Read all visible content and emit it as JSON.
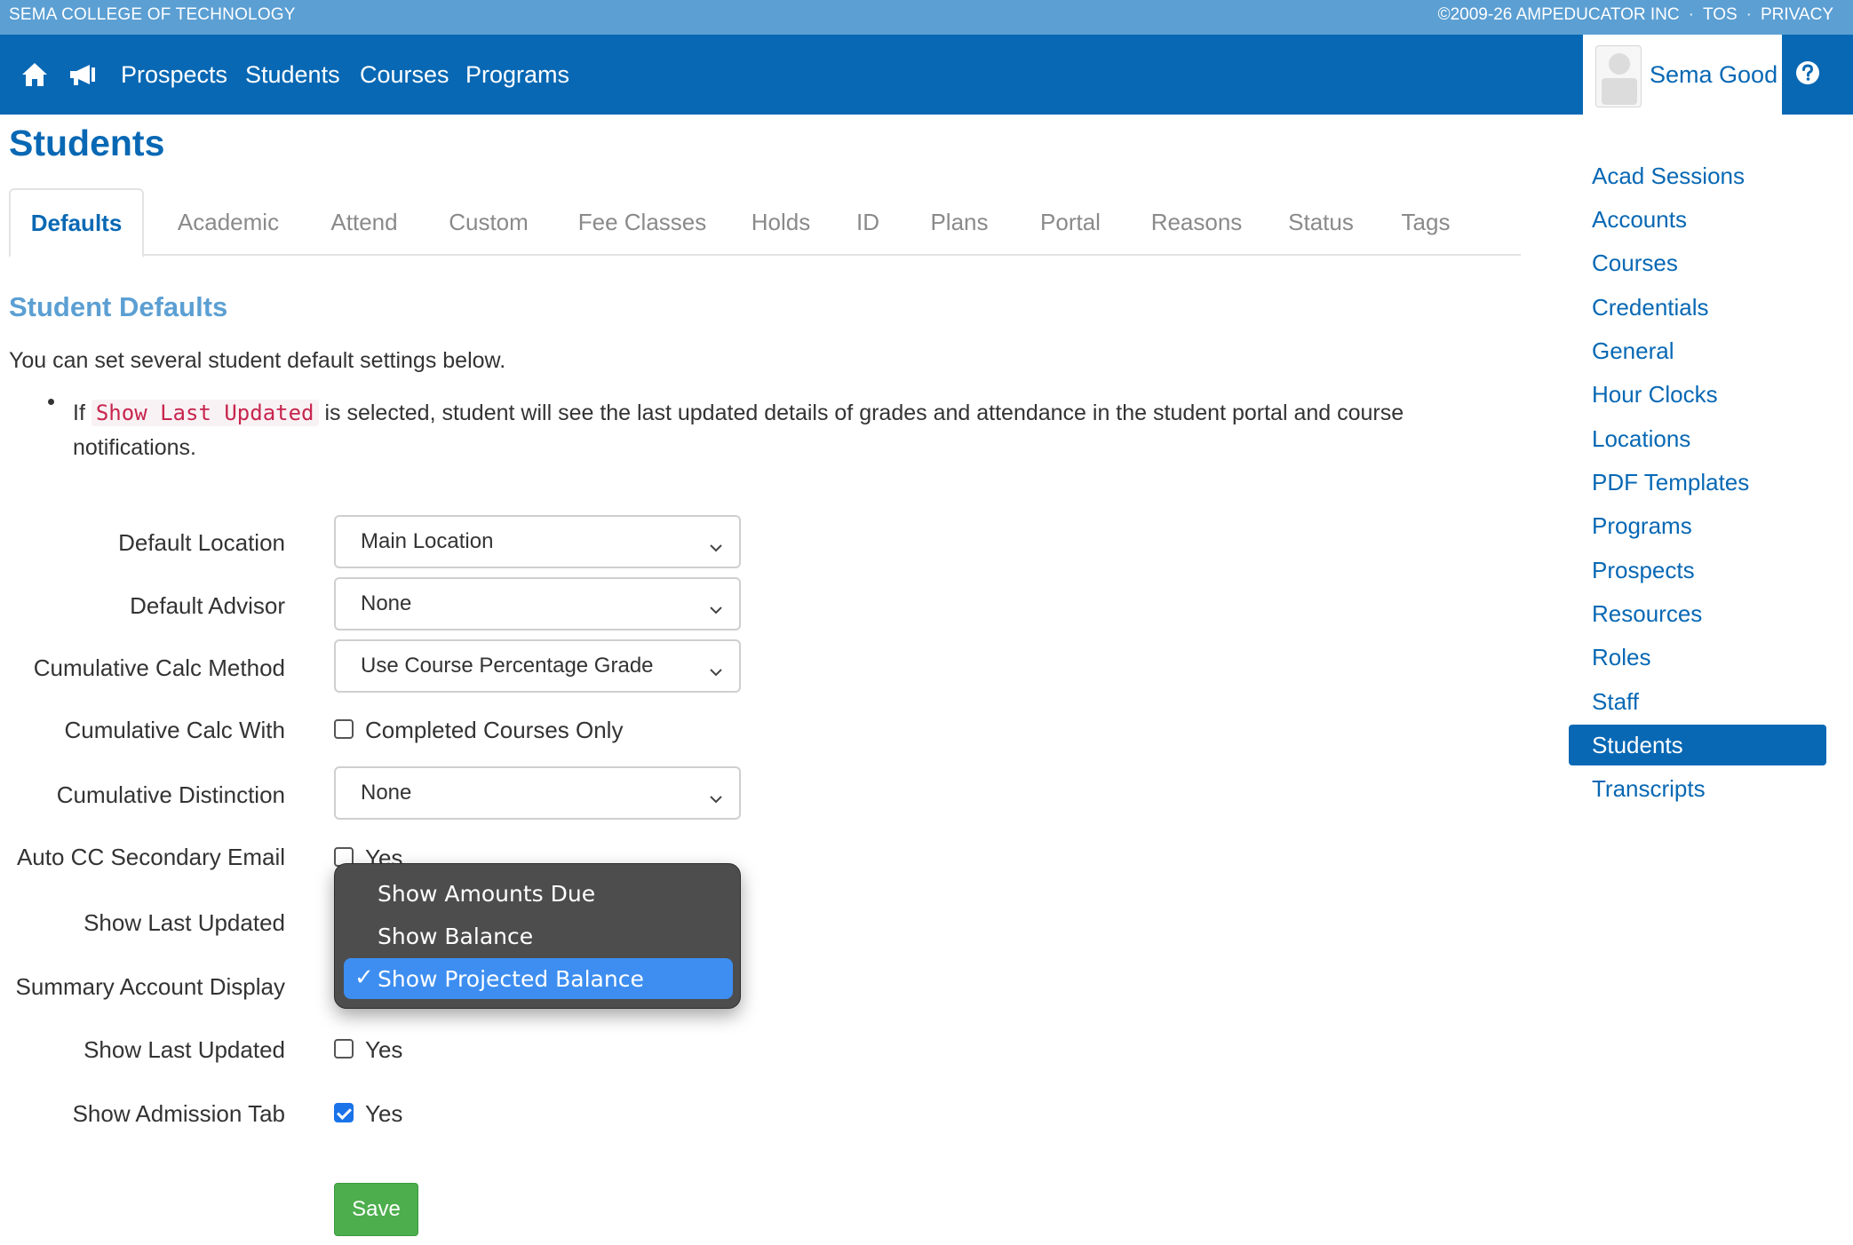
{
  "topbar": {
    "school": "SEMA COLLEGE OF TECHNOLOGY",
    "copyright": "©2009-26 AMPEDUCATOR INC",
    "tos": "TOS",
    "privacy": "PRIVACY",
    "separator": "·"
  },
  "nav": {
    "links": [
      "Prospects",
      "Students",
      "Courses",
      "Programs"
    ],
    "user_name": "Sema Good"
  },
  "page": {
    "title": "Students"
  },
  "tabs": [
    "Defaults",
    "Academic",
    "Attend",
    "Custom",
    "Fee Classes",
    "Holds",
    "ID",
    "Plans",
    "Portal",
    "Reasons",
    "Status",
    "Tags"
  ],
  "active_tab": "Defaults",
  "section": {
    "title": "Student Defaults",
    "intro": "You can set several student default settings below.",
    "note_prefix": "If",
    "note_code": "Show Last Updated",
    "note_suffix": "is selected, student will see the last updated details of grades and attendance in the student portal and course notifications."
  },
  "form": {
    "default_location": {
      "label": "Default Location",
      "value": "Main Location"
    },
    "default_advisor": {
      "label": "Default Advisor",
      "value": "None"
    },
    "cumulative_calc_method": {
      "label": "Cumulative Calc Method",
      "value": "Use Course Percentage Grade"
    },
    "cumulative_calc_with": {
      "label": "Cumulative Calc With",
      "option": "Completed Courses Only",
      "checked": false
    },
    "cumulative_distinction": {
      "label": "Cumulative Distinction",
      "value": "None"
    },
    "auto_cc_secondary_email": {
      "label": "Auto CC Secondary Email",
      "option": "Yes",
      "checked": false
    },
    "show_last_updated_1": {
      "label": "Show Last Updated"
    },
    "summary_account_display": {
      "label": "Summary Account Display",
      "options": [
        "Show Amounts Due",
        "Show Balance",
        "Show Projected Balance"
      ],
      "selected": "Show Projected Balance",
      "check_mark": "✓"
    },
    "show_last_updated_2": {
      "label": "Show Last Updated",
      "option": "Yes",
      "checked": false
    },
    "show_admission_tab": {
      "label": "Show Admission Tab",
      "option": "Yes",
      "checked": true
    },
    "save_label": "Save"
  },
  "sidebar": {
    "items": [
      "Acad Sessions",
      "Accounts",
      "Courses",
      "Credentials",
      "General",
      "Hour Clocks",
      "Locations",
      "PDF Templates",
      "Programs",
      "Prospects",
      "Resources",
      "Roles",
      "Staff",
      "Students",
      "Transcripts"
    ],
    "active": "Students"
  },
  "colors": {
    "nav_blue": "#0868b4",
    "top_strip": "#5b9fd3",
    "save_green": "#4cae4c",
    "dropdown_bg": "#4d4d4d",
    "dropdown_selected": "#3d8ef0"
  },
  "icons": {
    "home": "home-icon",
    "announce": "megaphone-icon",
    "help": "question-circle-icon",
    "chevron": "chevron-down-icon",
    "check": "check-icon"
  }
}
